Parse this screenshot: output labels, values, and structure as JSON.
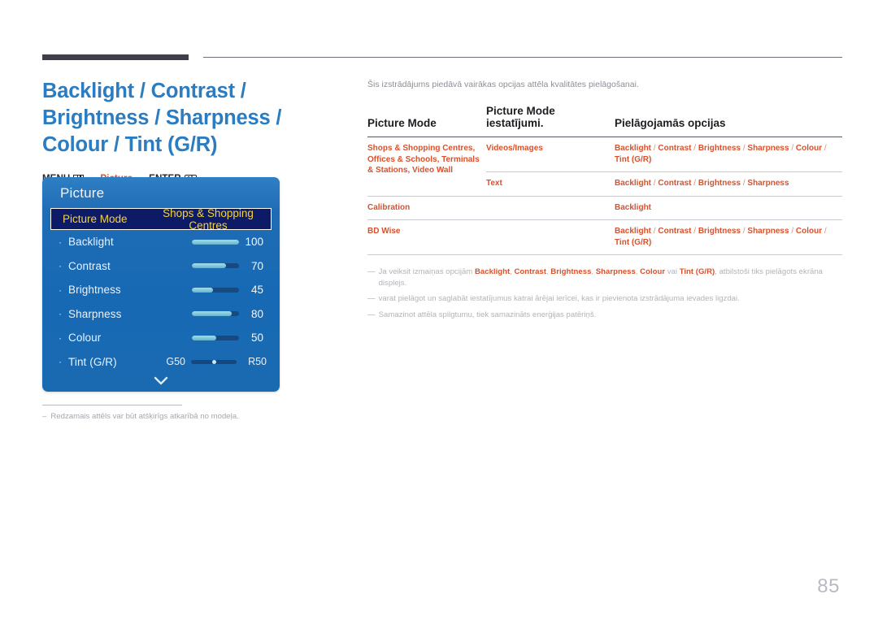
{
  "header": {
    "title": "Backlight / Contrast / Brightness / Sharpness / Colour / Tint (G/R)",
    "menu_path": {
      "menu_label": "MENU",
      "menu_icon": "menu-grid-icon",
      "arrow1": "→",
      "accent_label": "Picture",
      "arrow2": "→",
      "enter_label": "ENTER",
      "enter_icon": "enter-key-icon",
      "enter_glyph": "↵"
    }
  },
  "osd": {
    "title": "Picture",
    "highlight": {
      "label": "Picture Mode",
      "value": "Shops & Shopping Centres"
    },
    "rows": [
      {
        "bullet": "·",
        "label": "Backlight",
        "value": "100",
        "fill_pct": 100
      },
      {
        "bullet": "·",
        "label": "Contrast",
        "value": "70",
        "fill_pct": 73
      },
      {
        "bullet": "·",
        "label": "Brightness",
        "value": "45",
        "fill_pct": 45
      },
      {
        "bullet": "·",
        "label": "Sharpness",
        "value": "80",
        "fill_pct": 84
      },
      {
        "bullet": "·",
        "label": "Colour",
        "value": "50",
        "fill_pct": 52
      }
    ],
    "tint_row": {
      "bullet": "·",
      "label": "Tint (G/R)",
      "left_value": "G50",
      "right_value": "R50",
      "knob_pct": 50
    },
    "scroll_down_icon": "chevron-down-icon"
  },
  "left_note": {
    "dash": "–",
    "text": "Redzamais attēls var būt atšķirīgs atkarībā no modeļa."
  },
  "right": {
    "intro": "Šis izstrādājums piedāvā vairākas opcijas attēla kvalitātes pielāgošanai.",
    "table": {
      "headers": [
        "Picture Mode",
        "Picture Mode iestatījumi.",
        "Pielāgojamās opcijas"
      ],
      "rows": [
        {
          "mode": "Shops & Shopping Centres, Offices & Schools, Terminals & Stations, Video Wall",
          "setting": "Videos/Images",
          "options": "Backlight / Contrast / Brightness / Sharpness / Colour / Tint (G/R)",
          "divider": "none",
          "mode_rowspan": 2
        },
        {
          "mode": "",
          "setting": "Text",
          "options": "Backlight / Contrast / Brightness / Sharpness",
          "divider": "partial"
        },
        {
          "mode": "Calibration",
          "setting": "",
          "options": "Backlight",
          "divider": "full"
        },
        {
          "mode": "BD Wise",
          "setting": "",
          "options": "Backlight / Contrast / Brightness / Sharpness / Colour / Tint (G/R)",
          "divider": "full"
        }
      ]
    },
    "notes": [
      {
        "dash": "—",
        "parts": [
          {
            "t": "Ja veiksit izmaiņas opcijām ",
            "b": false
          },
          {
            "t": "Backlight",
            "b": true
          },
          {
            "t": ", ",
            "b": false
          },
          {
            "t": "Contrast",
            "b": true
          },
          {
            "t": ", ",
            "b": false
          },
          {
            "t": "Brightness",
            "b": true
          },
          {
            "t": ", ",
            "b": false
          },
          {
            "t": "Sharpness",
            "b": true
          },
          {
            "t": ", ",
            "b": false
          },
          {
            "t": "Colour",
            "b": true
          },
          {
            "t": " vai ",
            "b": false
          },
          {
            "t": "Tint (G/R)",
            "b": true
          },
          {
            "t": ", atbilstoši tiks pielāgots ekrāna displejs.",
            "b": false
          }
        ]
      },
      {
        "dash": "—",
        "parts": [
          {
            "t": "varat pielāgot un saglabāt iestatījumus katrai ārējai ierīcei, kas ir pievienota izstrādājuma ievades ligzdai.",
            "b": false
          }
        ]
      },
      {
        "dash": "—",
        "parts": [
          {
            "t": "Samazinot attēla spilgtumu, tiek samazināts enerģijas patēriņš.",
            "b": false
          }
        ]
      }
    ]
  },
  "page_number": "85",
  "colors": {
    "accent_blue": "#2b7cc0",
    "accent_orange": "#d9512c",
    "osd_blue": "#1f6cb5",
    "osd_highlight_bg": "#0d1a66",
    "osd_highlight_text": "#f5d33a",
    "note_gray": "#b3b3ba",
    "rule_dark": "#3f3f4c"
  }
}
